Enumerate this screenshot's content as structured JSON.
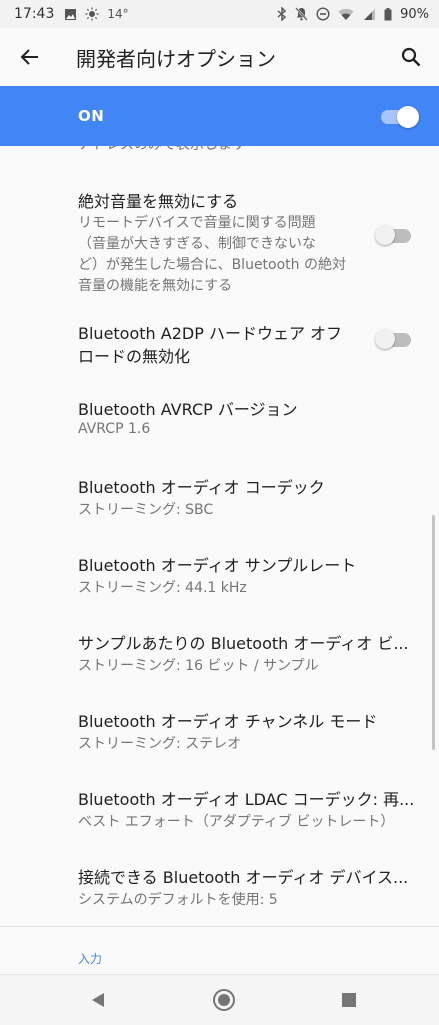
{
  "status_bar": {
    "time": "17:43",
    "temperature": "14°",
    "battery": "90%"
  },
  "app_bar": {
    "title": "開発者向けオプション"
  },
  "master_switch": {
    "label": "ON",
    "state": "on"
  },
  "partial_text": "アドレスのみで表示します",
  "items": [
    {
      "title": "絶対音量を無効にする",
      "summary_lines": [
        "リモートデバイスで音量に関する問題",
        "（音量が大きすぎる、制御できないな",
        "ど）が発生した場合に、Bluetooth の絶対",
        "音量の機能を無効にする"
      ],
      "toggle": "off"
    },
    {
      "title_lines": [
        "Bluetooth A2DP ハードウェア オフ",
        "ロードの無効化"
      ],
      "toggle": "off"
    },
    {
      "title": "Bluetooth AVRCP バージョン",
      "summary": "AVRCP 1.6"
    },
    {
      "title": "Bluetooth オーディオ コーデック",
      "summary": "ストリーミング: SBC"
    },
    {
      "title": "Bluetooth オーディオ サンプルレート",
      "summary": "ストリーミング: 44.1 kHz"
    },
    {
      "title": "サンプルあたりの Bluetooth オーディオ ビ...",
      "summary": "ストリーミング: 16 ビット / サンプル"
    },
    {
      "title": "Bluetooth オーディオ チャンネル モード",
      "summary": "ストリーミング: ステレオ"
    },
    {
      "title": "Bluetooth オーディオ LDAC コーデック: 再...",
      "summary": "ベスト エフォート（アダプティブ ビットレート）"
    },
    {
      "title": "接続できる Bluetooth オーディオ デバイス...",
      "summary": "システムのデフォルトを使用: 5"
    }
  ],
  "section_header": "入力",
  "colors": {
    "accent": "#4285f4",
    "background": "#fafafa",
    "title_text": "#212121",
    "summary_text": "#757575"
  }
}
